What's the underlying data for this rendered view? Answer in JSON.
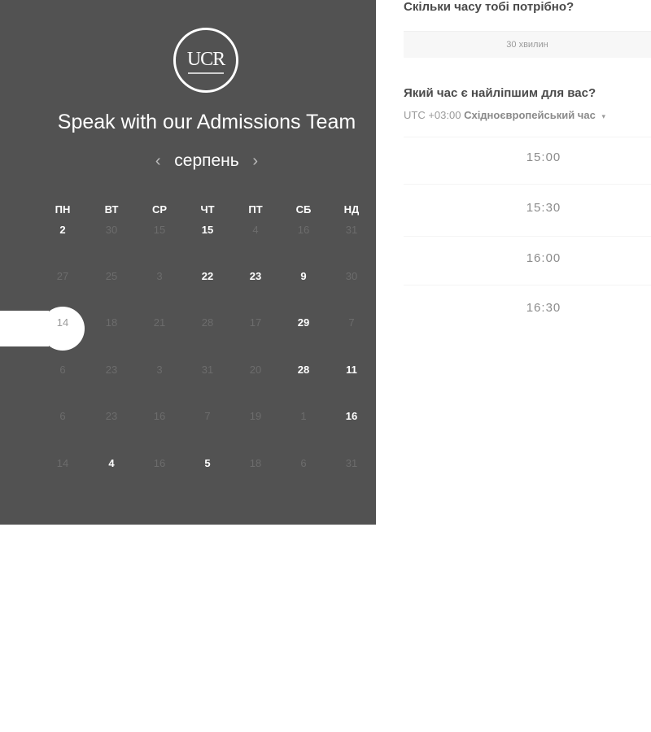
{
  "panel": {
    "logo_text": "UCR",
    "title": "Speak with our Admissions Team",
    "month": "серпень",
    "prev_arrow": "‹",
    "next_arrow": "›",
    "weekdays": [
      "ПН",
      "ВТ",
      "СР",
      "ЧТ",
      "ПТ",
      "СБ",
      "НД"
    ],
    "weeks": [
      [
        "2",
        "30",
        "15",
        "15",
        "4",
        "16",
        "31"
      ],
      [
        "27",
        "25",
        "3",
        "22",
        "23",
        "9",
        "30"
      ],
      [
        "14",
        "18",
        "21",
        "28",
        "17",
        "29",
        "7"
      ],
      [
        "6",
        "23",
        "3",
        "31",
        "20",
        "28",
        "11"
      ],
      [
        "6",
        "23",
        "16",
        "7",
        "19",
        "1",
        "16"
      ],
      [
        "14",
        "4",
        "16",
        "5",
        "18",
        "6",
        "31"
      ]
    ],
    "active_days": [
      [
        true,
        false,
        false,
        true,
        false,
        false,
        false
      ],
      [
        false,
        false,
        false,
        true,
        true,
        true,
        false
      ],
      [
        false,
        false,
        false,
        false,
        false,
        true,
        false
      ],
      [
        false,
        false,
        false,
        false,
        false,
        true,
        true
      ],
      [
        false,
        false,
        false,
        false,
        false,
        false,
        true
      ],
      [
        false,
        true,
        false,
        true,
        false,
        false,
        false
      ]
    ],
    "selected_day": {
      "week": 2,
      "weekday": 0
    }
  },
  "booking": {
    "duration_question": "Скільки часу тобі потрібно?",
    "duration_value": "30 хвилин",
    "time_question": "Який час є найліпшим для вас?",
    "timezone_offset": "UTC +03:00",
    "timezone_name": "Східноєвропейський час",
    "timezone_caret": "▾",
    "time_slots": [
      "15:00",
      "15:30",
      "16:00",
      "16:30"
    ]
  },
  "colors": {
    "panel_bg": "#525252",
    "muted_day": "#6c6c6c",
    "active_day": "#ffffff",
    "slot_text": "#8c8c8c"
  }
}
